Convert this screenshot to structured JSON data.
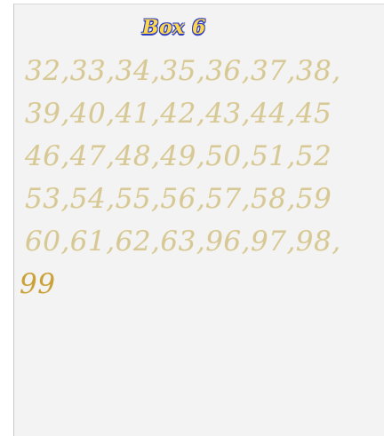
{
  "title": "Box 6",
  "lines": [
    "32,33,34,35,36,37,38,",
    "39,40,41,42,43,44,45",
    "46,47,48,49,50,51,52",
    "53,54,55,56,57,58,59",
    "60,61,62,63,96,97,98,",
    "99"
  ],
  "colors": {
    "title_fill": "#ffd84a",
    "title_outline": "#2d3cc4",
    "text": "#d7c997",
    "text_last": "#caa13b",
    "panel": "#f3f3f3"
  }
}
